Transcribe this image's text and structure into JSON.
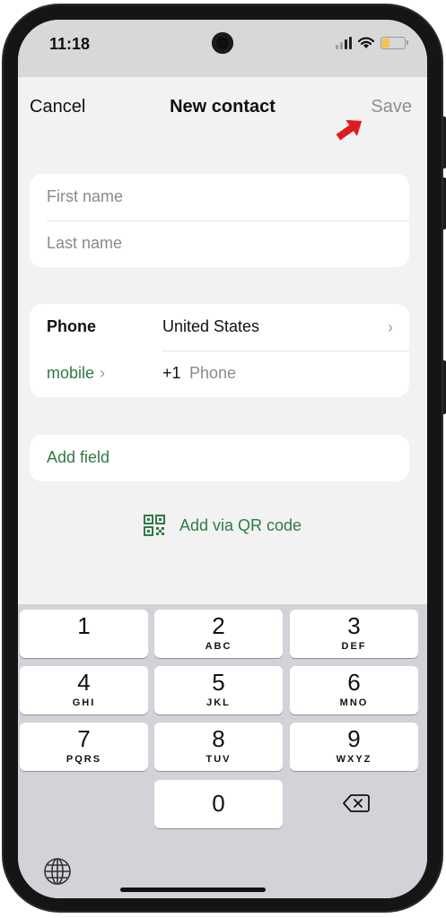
{
  "status_bar": {
    "time": "11:18"
  },
  "nav": {
    "cancel": "Cancel",
    "title": "New contact",
    "save": "Save"
  },
  "name_card": {
    "first_name_placeholder": "First name",
    "last_name_placeholder": "Last name"
  },
  "phone_card": {
    "label": "Phone",
    "country": "United States",
    "type": "mobile",
    "country_code": "+1",
    "number_placeholder": "Phone"
  },
  "add_field": {
    "label": "Add field"
  },
  "qr": {
    "label": "Add via QR code"
  },
  "keypad": {
    "keys": [
      {
        "num": "1",
        "letters": ""
      },
      {
        "num": "2",
        "letters": "ABC"
      },
      {
        "num": "3",
        "letters": "DEF"
      },
      {
        "num": "4",
        "letters": "GHI"
      },
      {
        "num": "5",
        "letters": "JKL"
      },
      {
        "num": "6",
        "letters": "MNO"
      },
      {
        "num": "7",
        "letters": "PQRS"
      },
      {
        "num": "8",
        "letters": "TUV"
      },
      {
        "num": "9",
        "letters": "WXYZ"
      },
      {
        "num": "0",
        "letters": ""
      }
    ]
  },
  "colors": {
    "accent_green": "#2f7a45",
    "annotation_red": "#e01b1b"
  }
}
